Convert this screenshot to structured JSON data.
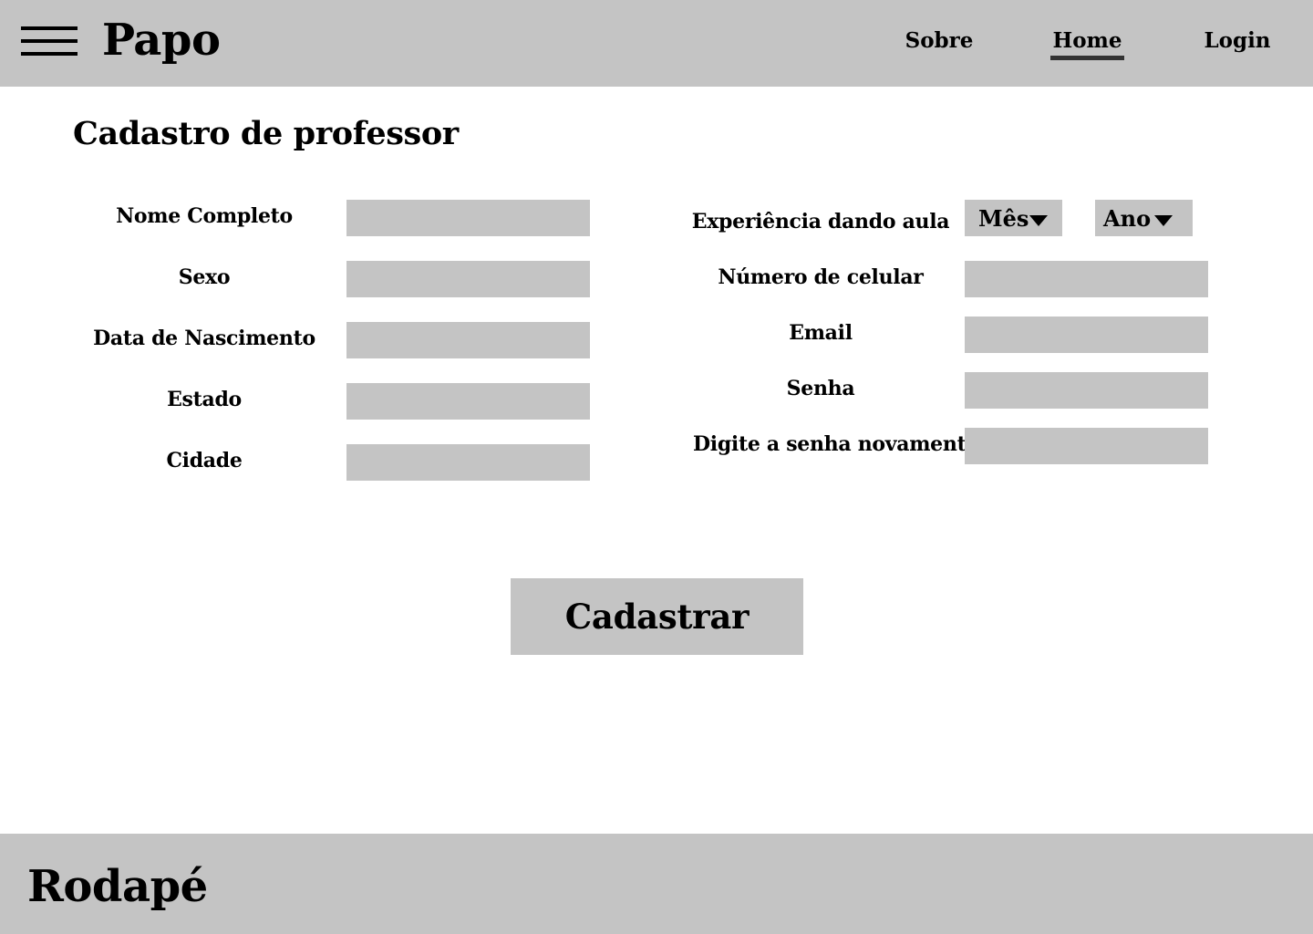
{
  "header": {
    "brand": "Papo",
    "nav": {
      "sobre": "Sobre",
      "home": "Home",
      "login": "Login"
    },
    "active_nav": "Home",
    "menu_icon": "hamburger-menu-icon"
  },
  "page": {
    "title": "Cadastro de professor"
  },
  "form": {
    "left": {
      "nome_completo": "Nome Completo",
      "sexo": "Sexo",
      "data_nascimento": "Data de Nascimento",
      "estado": "Estado",
      "cidade": "Cidade"
    },
    "right": {
      "experiencia": "Experiência dando aula",
      "mes": "Mês",
      "ano": "Ano",
      "celular": "Número de celular",
      "email": "Email",
      "senha": "Senha",
      "senha_confirm": "Digite a senha novamente"
    },
    "submit_label": "Cadastrar"
  },
  "footer": {
    "title": "Rodapé"
  },
  "colors": {
    "bar_background": "#c4c4c4",
    "field_background": "#c4c4c4",
    "text": "#000000",
    "page_background": "#ffffff"
  }
}
